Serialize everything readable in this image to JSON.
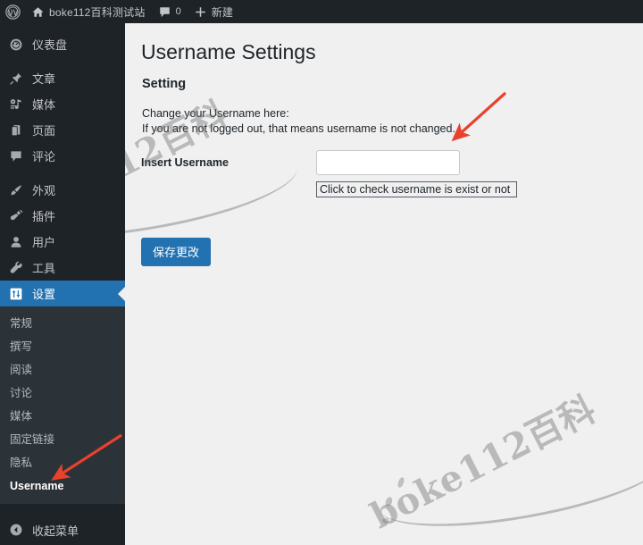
{
  "adminbar": {
    "logo_icon": "wordpress-logo-icon",
    "home_icon": "home-icon",
    "site_name": "boke112百科测试站",
    "comments_icon": "comment-bubble-icon",
    "comments_count": "0",
    "new_icon": "plus-icon",
    "new_label": "新建"
  },
  "sidebar": {
    "items": [
      {
        "label": "仪表盘",
        "icon": "dashboard-gauge-icon",
        "name": "dashboard",
        "active": false,
        "sep_after": true
      },
      {
        "label": "文章",
        "icon": "pushpin-icon",
        "name": "posts",
        "active": false,
        "sep_after": false
      },
      {
        "label": "媒体",
        "icon": "media-music-icon",
        "name": "media",
        "active": false,
        "sep_after": false
      },
      {
        "label": "页面",
        "icon": "pages-icon",
        "name": "pages",
        "active": false,
        "sep_after": false
      },
      {
        "label": "评论",
        "icon": "comment-bubble-icon",
        "name": "comments",
        "active": false,
        "sep_after": true
      },
      {
        "label": "外观",
        "icon": "paintbrush-icon",
        "name": "appearance",
        "active": false,
        "sep_after": false
      },
      {
        "label": "插件",
        "icon": "plug-icon",
        "name": "plugins",
        "active": false,
        "sep_after": false
      },
      {
        "label": "用户",
        "icon": "user-icon",
        "name": "users",
        "active": false,
        "sep_after": false
      },
      {
        "label": "工具",
        "icon": "wrench-icon",
        "name": "tools",
        "active": false,
        "sep_after": false
      },
      {
        "label": "设置",
        "icon": "settings-sliders-icon",
        "name": "settings",
        "active": true,
        "sep_after": false
      }
    ],
    "submenu": [
      {
        "label": "常规",
        "name": "general",
        "current": false
      },
      {
        "label": "撰写",
        "name": "writing",
        "current": false
      },
      {
        "label": "阅读",
        "name": "reading",
        "current": false
      },
      {
        "label": "讨论",
        "name": "discussion",
        "current": false
      },
      {
        "label": "媒体",
        "name": "media",
        "current": false
      },
      {
        "label": "固定链接",
        "name": "permalinks",
        "current": false
      },
      {
        "label": "隐私",
        "name": "privacy",
        "current": false
      },
      {
        "label": "Username",
        "name": "username",
        "current": true
      }
    ],
    "collapse_label": "收起菜单",
    "collapse_icon": "collapse-left-arrow-icon"
  },
  "main": {
    "page_title": "Username Settings",
    "section_title": "Setting",
    "description_line1": "Change your Username here:",
    "description_line2": "If you are not logged out, that means username is not changed.",
    "field_label": "Insert Username",
    "username_value": "",
    "username_placeholder": "",
    "check_button_label": "Click to check username is exist or not",
    "save_button_label": "保存更改"
  },
  "watermark": {
    "text": "boke112百科"
  },
  "colors": {
    "admin_bar": "#1d2327",
    "sidebar": "#1d2327",
    "submenu": "#2c3338",
    "accent_blue": "#2271b1",
    "content_bg": "#f0f0f1",
    "arrow_red": "#e8412c"
  }
}
